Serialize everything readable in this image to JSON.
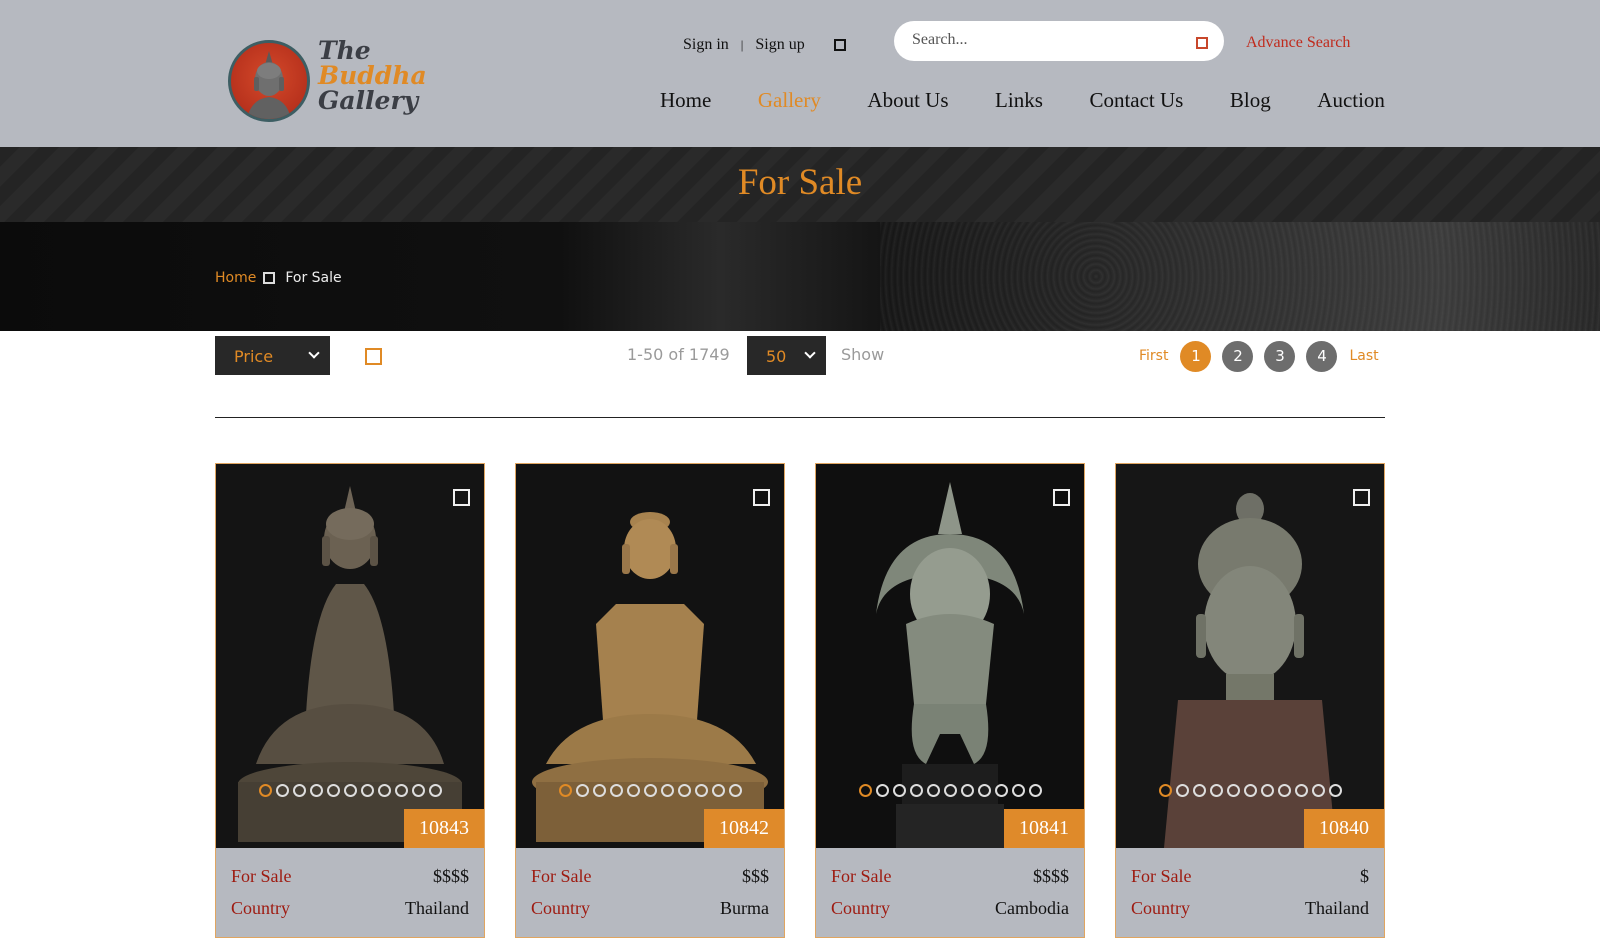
{
  "logo": {
    "line1": "The",
    "line2": "Buddha",
    "line3": "Gallery"
  },
  "auth": {
    "sign_in": "Sign in",
    "separator": "|",
    "sign_up": "Sign up"
  },
  "search": {
    "placeholder": "Search...",
    "advance": "Advance Search"
  },
  "nav": [
    {
      "label": "Home",
      "active": false
    },
    {
      "label": "Gallery",
      "active": true
    },
    {
      "label": "About Us",
      "active": false
    },
    {
      "label": "Links",
      "active": false
    },
    {
      "label": "Contact Us",
      "active": false
    },
    {
      "label": "Blog",
      "active": false
    },
    {
      "label": "Auction",
      "active": false
    }
  ],
  "page_title": "For Sale",
  "breadcrumb": {
    "home": "Home",
    "current": "For Sale"
  },
  "toolbar": {
    "sort_label": "Price",
    "count_text": "1-50 of 1749",
    "per_page": "50",
    "show_label": "Show"
  },
  "pager": {
    "first": "First",
    "pages": [
      "1",
      "2",
      "3",
      "4"
    ],
    "active_page": "1",
    "last": "Last"
  },
  "colors": {
    "accent": "#e08a25",
    "header_bg": "#b6b9c0",
    "label_red": "#9e1a10",
    "id_tag": "#df8a2a"
  },
  "cards": [
    {
      "id": "10843",
      "status_label": "For Sale",
      "price": "$$$$",
      "country_label": "Country",
      "country": "Thailand",
      "image": "seated-bronze-buddha-statue"
    },
    {
      "id": "10842",
      "status_label": "For Sale",
      "price": "$$$",
      "country_label": "Country",
      "country": "Burma",
      "image": "seated-gilded-buddha-statue"
    },
    {
      "id": "10841",
      "status_label": "For Sale",
      "price": "$$$$",
      "country_label": "Country",
      "country": "Cambodia",
      "image": "bronze-garuda-statue"
    },
    {
      "id": "10840",
      "status_label": "For Sale",
      "price": "$",
      "country_label": "Country",
      "country": "Thailand",
      "image": "bronze-buddha-head-on-stand"
    }
  ]
}
